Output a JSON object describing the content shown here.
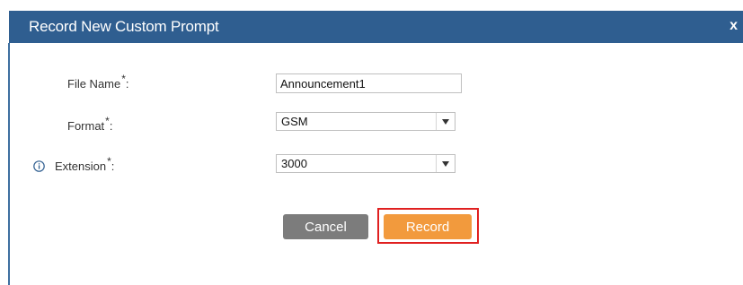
{
  "dialog": {
    "title": "Record New Custom Prompt",
    "close_label": "x"
  },
  "form": {
    "file_name": {
      "label": "File Name",
      "required_mark": "*",
      "colon": ":",
      "value": "Announcement1"
    },
    "format": {
      "label": "Format",
      "required_mark": "*",
      "colon": ":",
      "selected": "GSM"
    },
    "extension": {
      "label": "Extension",
      "required_mark": "*",
      "colon": ":",
      "selected": "3000",
      "info_icon": "info-circle-icon"
    }
  },
  "buttons": {
    "cancel_label": "Cancel",
    "record_label": "Record"
  },
  "colors": {
    "titlebar": "#2f5e90",
    "cancel": "#7c7c7c",
    "record": "#f29a3d",
    "highlight": "#e02020"
  }
}
